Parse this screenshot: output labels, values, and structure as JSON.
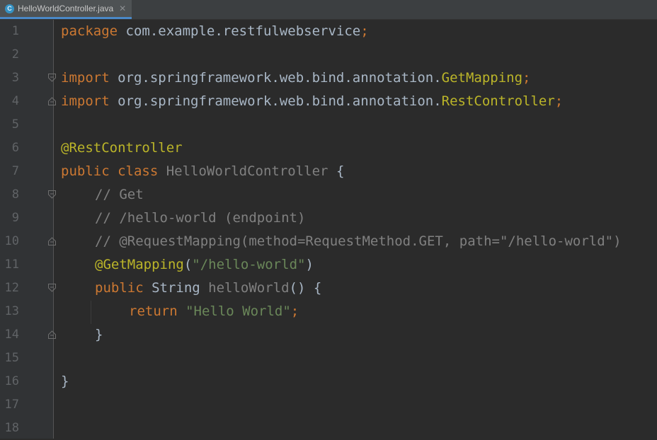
{
  "tab": {
    "icon_letter": "C",
    "filename": "HelloWorldController.java",
    "close": "✕"
  },
  "line_numbers": [
    "1",
    "2",
    "3",
    "4",
    "5",
    "6",
    "7",
    "8",
    "9",
    "10",
    "11",
    "12",
    "13",
    "14",
    "15",
    "16",
    "17",
    "18"
  ],
  "code": {
    "l1": {
      "kw": "package",
      "rest": " com.example.restfulwebservice",
      "semi": ";"
    },
    "l3": {
      "kw": "import",
      "pkg": " org.springframework.web.bind.annotation.",
      "cls": "GetMapping",
      "semi": ";"
    },
    "l4": {
      "kw": "import",
      "pkg": " org.springframework.web.bind.annotation.",
      "cls": "RestController",
      "semi": ";"
    },
    "l6": {
      "ann": "@RestController"
    },
    "l7": {
      "kw": "public class",
      "name": " HelloWorldController",
      "brace": " {"
    },
    "l8": {
      "cmt": "// Get"
    },
    "l9": {
      "cmt": "// /hello-world (endpoint)"
    },
    "l10": {
      "cmt": "// @RequestMapping(method=RequestMethod.GET, path=\"/hello-world\")"
    },
    "l11": {
      "ann": "@GetMapping",
      "open": "(",
      "str": "\"/hello-world\"",
      "close": ")"
    },
    "l12": {
      "kw": "public",
      "type": " String ",
      "meth": "helloWorld",
      "rest": "() {"
    },
    "l13": {
      "kw": "return",
      "str": " \"Hello World\"",
      "semi": ";"
    },
    "l14": {
      "brace": "}"
    },
    "l16": {
      "brace": "}"
    }
  },
  "colors": {
    "background": "#2b2b2b",
    "gutter": "#313335",
    "keyword": "#cc7832",
    "annotation": "#bbb529",
    "string": "#6a8759",
    "comment": "#808080",
    "text": "#a9b7c6"
  }
}
